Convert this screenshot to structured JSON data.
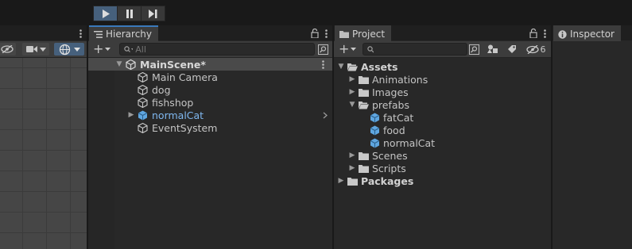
{
  "toolbar": {
    "play": "play-button",
    "pause": "pause-button",
    "step": "step-button"
  },
  "hierarchy": {
    "tab_label": "Hierarchy",
    "search_placeholder": "All",
    "scene_name": "MainScene*",
    "items": [
      "Main Camera",
      "dog",
      "fishshop",
      "normalCat",
      "EventSystem"
    ]
  },
  "project": {
    "tab_label": "Project",
    "hidden_count": "6",
    "tree": {
      "assets": "Assets",
      "animations": "Animations",
      "images": "Images",
      "prefabs": "prefabs",
      "prefab_items": [
        "fatCat",
        "food",
        "normalCat"
      ],
      "scenes": "Scenes",
      "scripts": "Scripts",
      "packages": "Packages"
    }
  },
  "inspector": {
    "tab_label": "Inspector"
  },
  "colors": {
    "accent": "#3a79bb",
    "prefab_text": "#7fb7ef",
    "panel_bg": "#282828"
  }
}
